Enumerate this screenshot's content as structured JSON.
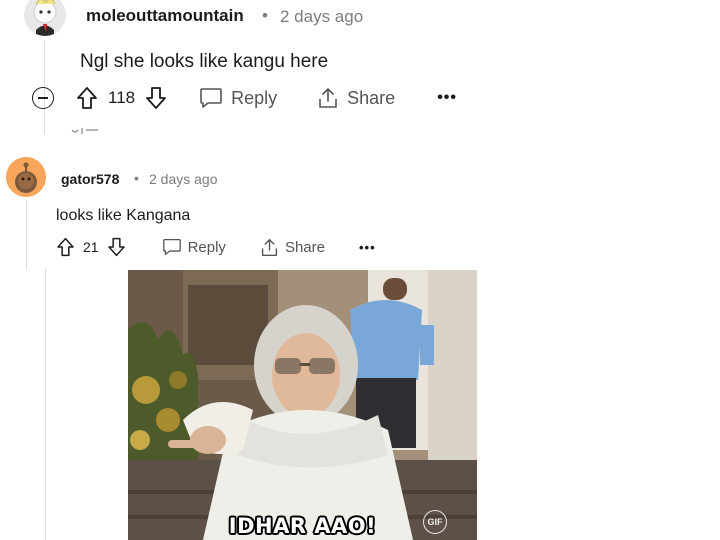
{
  "comments": [
    {
      "author": "moleouttamountain",
      "separator": "•",
      "time": "2 days ago",
      "body": "Ngl she looks like kangu here",
      "score": "118",
      "reply_label": "Reply",
      "share_label": "Share",
      "more_label": "•••"
    },
    {
      "author": "gator578",
      "separator": "•",
      "time": "2 days ago",
      "body": "looks like Kangana",
      "score": "21",
      "reply_label": "Reply",
      "share_label": "Share",
      "more_label": "•••",
      "gif": {
        "caption": "IDHAR AAO!",
        "badge": "GIF"
      }
    }
  ],
  "colors": {
    "text": "#1c1c1c",
    "meta": "#7c7c7c",
    "action": "#555555",
    "avatar2_bg": "#f7a65c"
  },
  "icons": [
    "collapse-icon",
    "upvote-icon",
    "downvote-icon",
    "comment-bubble-icon",
    "share-icon",
    "more-icon"
  ]
}
